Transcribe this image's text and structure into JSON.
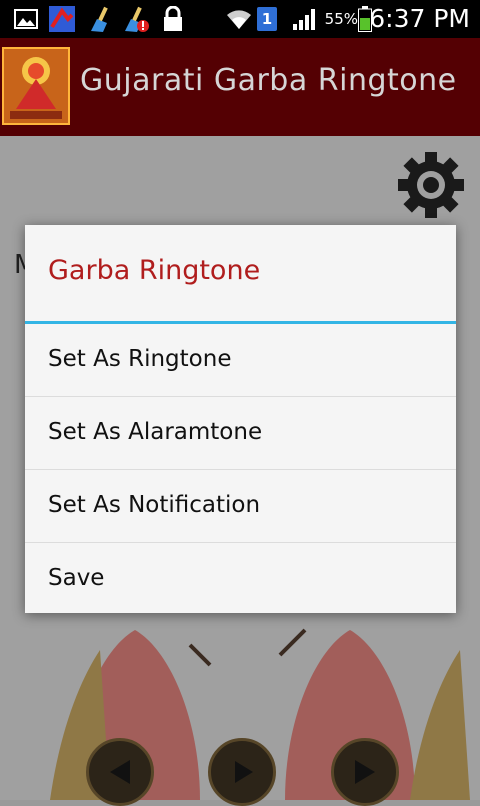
{
  "status_bar": {
    "battery_percent": "55%",
    "time": "6:37 PM",
    "notification_badge": "1",
    "icons": [
      "gallery-icon",
      "app-notification-icon",
      "clean-master-icon",
      "clean-master-alert-icon",
      "lock-icon",
      "wifi-icon",
      "sim-badge-icon",
      "signal-icon",
      "battery-icon"
    ]
  },
  "app_bar": {
    "title": "Gujarati Garba Ringtone",
    "logo_icon": "durga-logo-icon"
  },
  "background": {
    "partial_text": "M",
    "settings_icon": "gear-icon",
    "nav_icons": [
      "previous-icon",
      "play-icon",
      "next-icon"
    ]
  },
  "dialog": {
    "title": "Garba Ringtone",
    "items": [
      {
        "label": "Set As Ringtone"
      },
      {
        "label": "Set As Alaramtone"
      },
      {
        "label": "Set As Notification"
      },
      {
        "label": "Save"
      }
    ]
  },
  "colors": {
    "action_bar": "#540003",
    "dialog_title": "#b01d1d",
    "dialog_divider": "#33b5e5"
  }
}
